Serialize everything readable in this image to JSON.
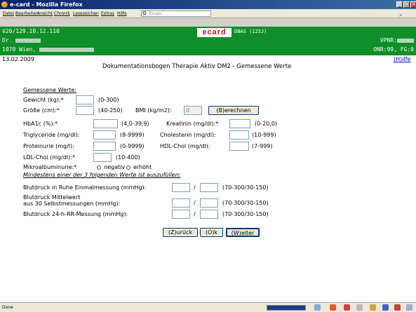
{
  "window": {
    "title": "e-card - Mozilla Firefox",
    "controls": [
      "_",
      "□",
      "×"
    ]
  },
  "menubar": {
    "items": [
      "Datei",
      "Bearbeiten",
      "Ansicht",
      "Chronik",
      "Lesezeichen",
      "Extras",
      "Hilfe"
    ],
    "search_placeholder": "Google"
  },
  "banner": {
    "line1_left": "V20/129.10.12.110",
    "line2_left": "Dr.",
    "line3_left": "1070 Wien,",
    "logo": "ecard",
    "logo_sub": "DBAS (125J)",
    "line2_right": "VPNR:",
    "line3_right": "ONR:99, FG:0"
  },
  "page": {
    "date": "13.02.2009",
    "help_link": "(H)ilfe",
    "heading": "Dokumentationsbogen Therapie Aktiv DM2 - Gemessene Werte",
    "section_title": "Gemessene Werte:",
    "fields": {
      "gewicht": {
        "label": "Gewicht (kg):*",
        "range": "(0-300)",
        "value": ""
      },
      "groesse": {
        "label": "Größe (cm):*",
        "range": "(40-250)",
        "value": ""
      },
      "bmi": {
        "label": "BMI (kg/m2):",
        "value": "0",
        "button": "(B)erechnen"
      },
      "hba1c": {
        "label": "HbA1c (%):*",
        "range": "(4,0-39,9)",
        "value": ""
      },
      "kreatinin": {
        "label": "Kreatinin (mg/dl):*",
        "range": "(0-20,0)",
        "value": ""
      },
      "triglyceride": {
        "label": "Triglyceride (mg/dl):",
        "range": "(8-9999)",
        "value": ""
      },
      "cholesterin": {
        "label": "Cholesterin (mg/dl):",
        "range": "(10-999)",
        "value": ""
      },
      "proteinurie": {
        "label": "Proteinurie (mg/l):",
        "range": "(0-9999)",
        "value": ""
      },
      "hdl": {
        "label": "HDL-Chol (mg/dl):",
        "range": "(7-999)",
        "value": ""
      },
      "ldl": {
        "label": "LDL-Chol (mg/dl):*",
        "range": "(10-400)",
        "value": ""
      }
    },
    "mikroalbuminurie": {
      "label": "Mikroalbuminurie:*",
      "options": [
        "negativ",
        "erhöht"
      ]
    },
    "bp_note": "Mindestens einer der 3 folgenden Werte ist auszufüllen:",
    "bp_rows": [
      {
        "label": "Blutdruck in Ruhe Einmalmessung (mmHg):",
        "range": "(70-300/30-150)"
      },
      {
        "label_line1": "Blutdruck Mittelwert",
        "label_line2": "aus 30 Selbstmessungen (mmHg):",
        "range": "(70-300/30-150)"
      },
      {
        "label": "Blutdruck 24-h-RR-Messung (mmHg):",
        "range": "(70-300/30-150)"
      }
    ],
    "slash": "/",
    "buttons": {
      "back": "(Z)urück",
      "ok": "(O)k",
      "next": "(W)eiter"
    }
  },
  "status": {
    "text": "Done"
  }
}
